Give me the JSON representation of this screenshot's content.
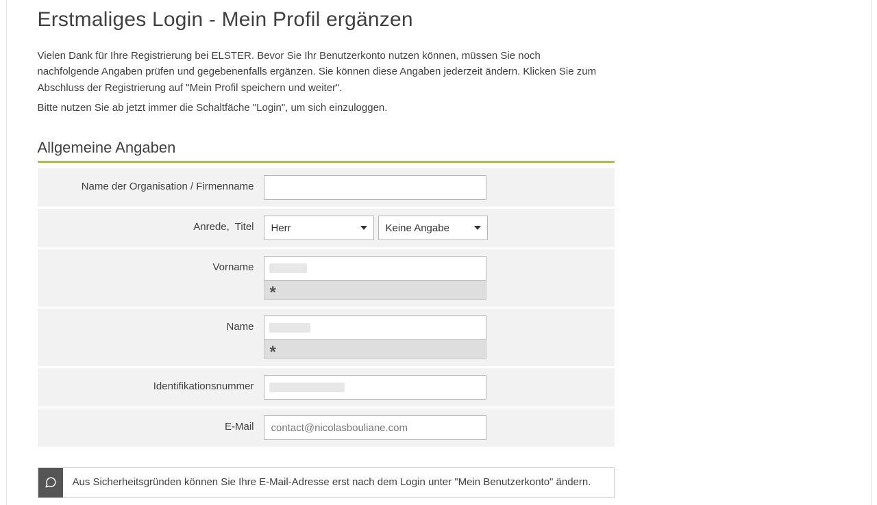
{
  "page": {
    "title": "Erstmaliges Login - Mein Profil ergänzen",
    "intro_p1": "Vielen Dank für Ihre Registrierung bei ELSTER. Bevor Sie Ihr Benutzerkonto nutzen können, müssen Sie noch nachfolgende Angaben prüfen und gegebenenfalls ergänzen. Sie können diese Angaben jederzeit ändern. Klicken Sie zum Abschluss der Registrierung auf \"Mein Profil speichern und weiter\".",
    "intro_p2": "Bitte nutzen Sie ab jetzt immer die Schaltfäche \"Login\", um sich einzuloggen.",
    "section_heading": "Allgemeine Angaben"
  },
  "form": {
    "org_label": "Name der Organisation / Firmenname",
    "org_value": "",
    "anrede_label": "Anrede",
    "titel_label": "Titel",
    "anrede_value": "Herr",
    "titel_value": "Keine Angabe",
    "vorname_label": "Vorname",
    "vorname_value": "",
    "name_label": "Name",
    "name_value": "",
    "idnr_label": "Identifikationsnummer",
    "idnr_value": "",
    "email_label": "E-Mail",
    "email_value": "contact@nicolasbouliane.com",
    "required_symbol": "*"
  },
  "notice": {
    "text": "Aus Sicherheitsgründen können Sie Ihre E-Mail-Adresse erst nach dem Login unter \"Mein Benutzerkonto\" ändern."
  }
}
